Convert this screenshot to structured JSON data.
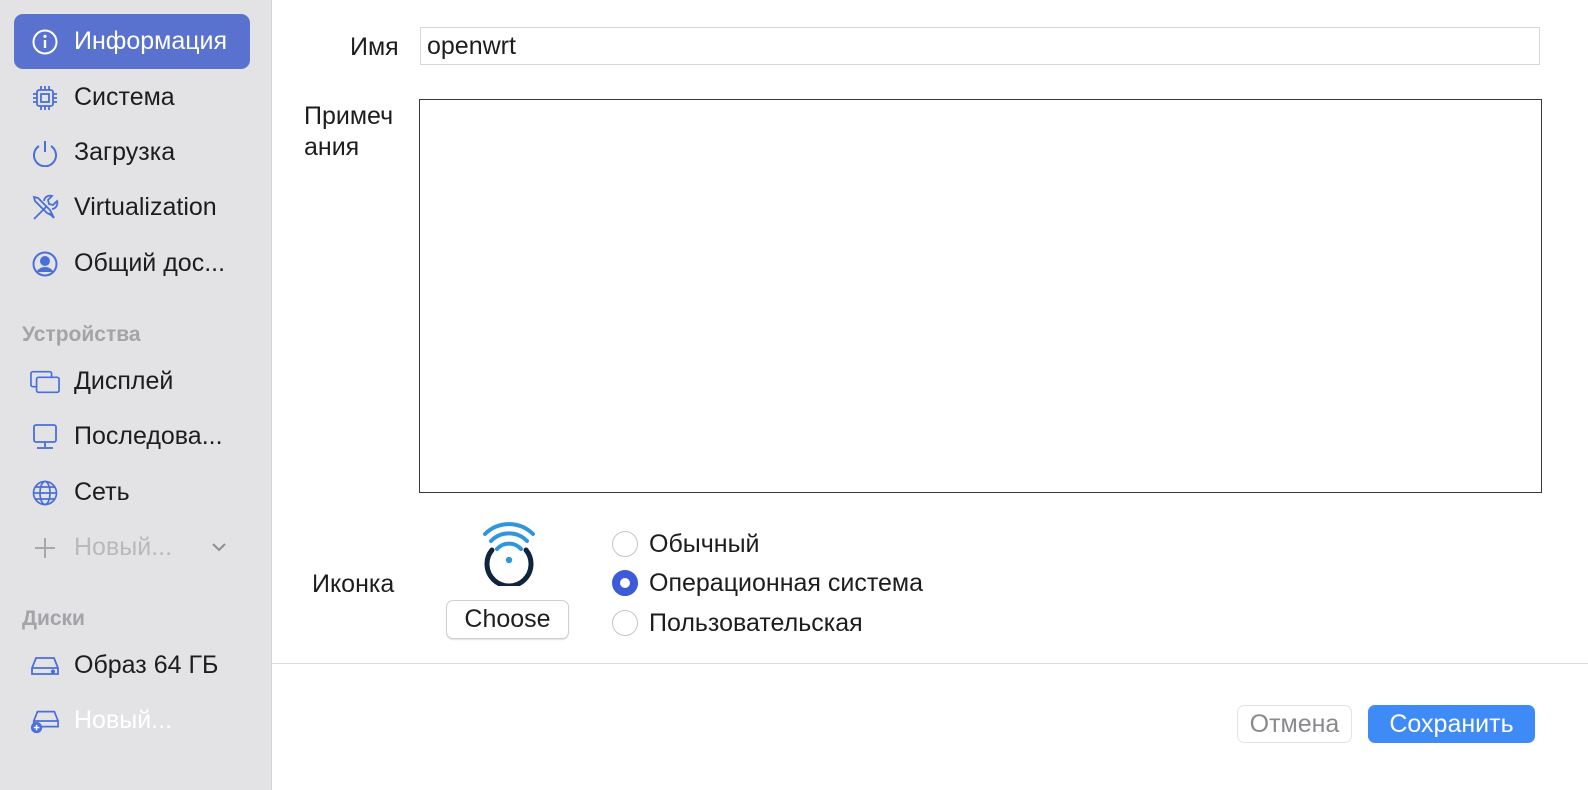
{
  "sidebar": {
    "items": [
      {
        "label": "Информация",
        "icon": "info-icon"
      },
      {
        "label": "Система",
        "icon": "cpu-chip-icon"
      },
      {
        "label": "Загрузка",
        "icon": "power-icon"
      },
      {
        "label": "Virtualization",
        "icon": "tools-icon"
      },
      {
        "label": "Общий дос...",
        "icon": "person-circle-icon"
      }
    ],
    "devices_header": "Устройства",
    "devices": [
      {
        "label": "Дисплей",
        "icon": "display-icon"
      },
      {
        "label": "Последова...",
        "icon": "terminal-icon"
      },
      {
        "label": "Сеть",
        "icon": "globe-icon"
      }
    ],
    "new_device_label": "Новый...",
    "drives_header": "Диски",
    "drives": [
      {
        "label": "Образ 64 ГБ",
        "icon": "drive-icon"
      },
      {
        "label": "Новый...",
        "icon": "add-drive-icon"
      }
    ],
    "accent_color": "#5a72cf"
  },
  "form": {
    "name_label": "Имя",
    "name_value": "openwrt",
    "notes_label_line1": "Примеч",
    "notes_label_line2": "ания",
    "notes_value": "",
    "icon_label": "Иконка",
    "choose_label": "Choose",
    "icon_options": [
      {
        "label": "Обычный",
        "checked": false
      },
      {
        "label": "Операционная система",
        "checked": true
      },
      {
        "label": "Пользовательская",
        "checked": false
      }
    ]
  },
  "footer": {
    "cancel_label": "Отмена",
    "save_label": "Сохранить",
    "save_color": "#3e8af6"
  }
}
